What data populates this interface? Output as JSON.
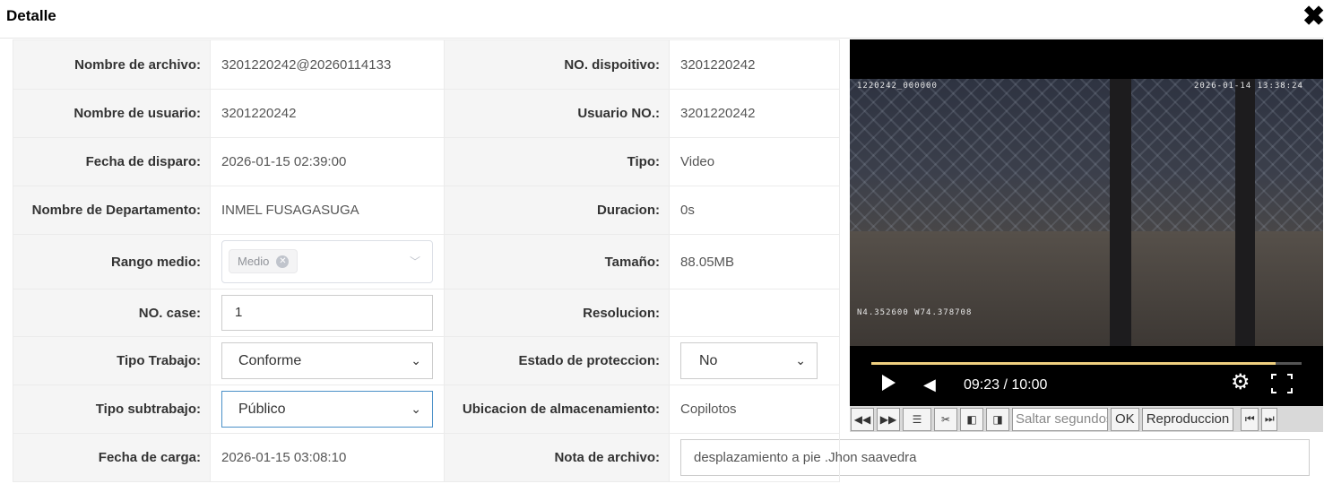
{
  "header": {
    "title": "Detalle",
    "close": "✖"
  },
  "rows": {
    "archivo": {
      "label": "Nombre de archivo:",
      "value": "3201220242@20260114133"
    },
    "dispositivo": {
      "label": "NO. dispoitivo:",
      "value": "3201220242"
    },
    "usuario": {
      "label": "Nombre de usuario:",
      "value": "3201220242"
    },
    "usuario_no": {
      "label": "Usuario NO.:",
      "value": "3201220242"
    },
    "fecha_disparo": {
      "label": "Fecha de disparo:",
      "value": "2026-01-15 02:39:00"
    },
    "tipo": {
      "label": "Tipo:",
      "value": "Video"
    },
    "departamento": {
      "label": "Nombre de Departamento:",
      "value": "INMEL FUSAGASUGA"
    },
    "duracion": {
      "label": "Duracion:",
      "value": "0s"
    },
    "rango": {
      "label": "Rango medio:",
      "tag": "Medio"
    },
    "tamano": {
      "label": "Tamaño:",
      "value": "88.05MB"
    },
    "case": {
      "label": "NO. case:",
      "value": "1"
    },
    "resolucion": {
      "label": "Resolucion:",
      "value": ""
    },
    "tipo_trabajo": {
      "label": "Tipo Trabajo:",
      "value": "Conforme"
    },
    "proteccion": {
      "label": "Estado de proteccion:",
      "value": "No"
    },
    "subtrabajo": {
      "label": "Tipo subtrabajo:",
      "value": "Público"
    },
    "ubicacion": {
      "label": "Ubicacion de almacenamiento:",
      "value": "Copilotos"
    },
    "fecha_carga": {
      "label": "Fecha de carga:",
      "value": "2026-01-15 03:08:10"
    },
    "nota": {
      "label": "Nota de archivo:",
      "value": "desplazamiento a pie .Jhon saavedra"
    }
  },
  "video": {
    "osd_id": "1220242_000000",
    "osd_date": "2026-01-14 13:38:24",
    "osd_gps": "N4.352600 W74.378708",
    "time": "09:23 / 10:00",
    "progress": 0.94
  },
  "toolbar": {
    "seek_placeholder": "Saltar segundos",
    "ok": "OK",
    "play_label": "Reproduccion"
  }
}
